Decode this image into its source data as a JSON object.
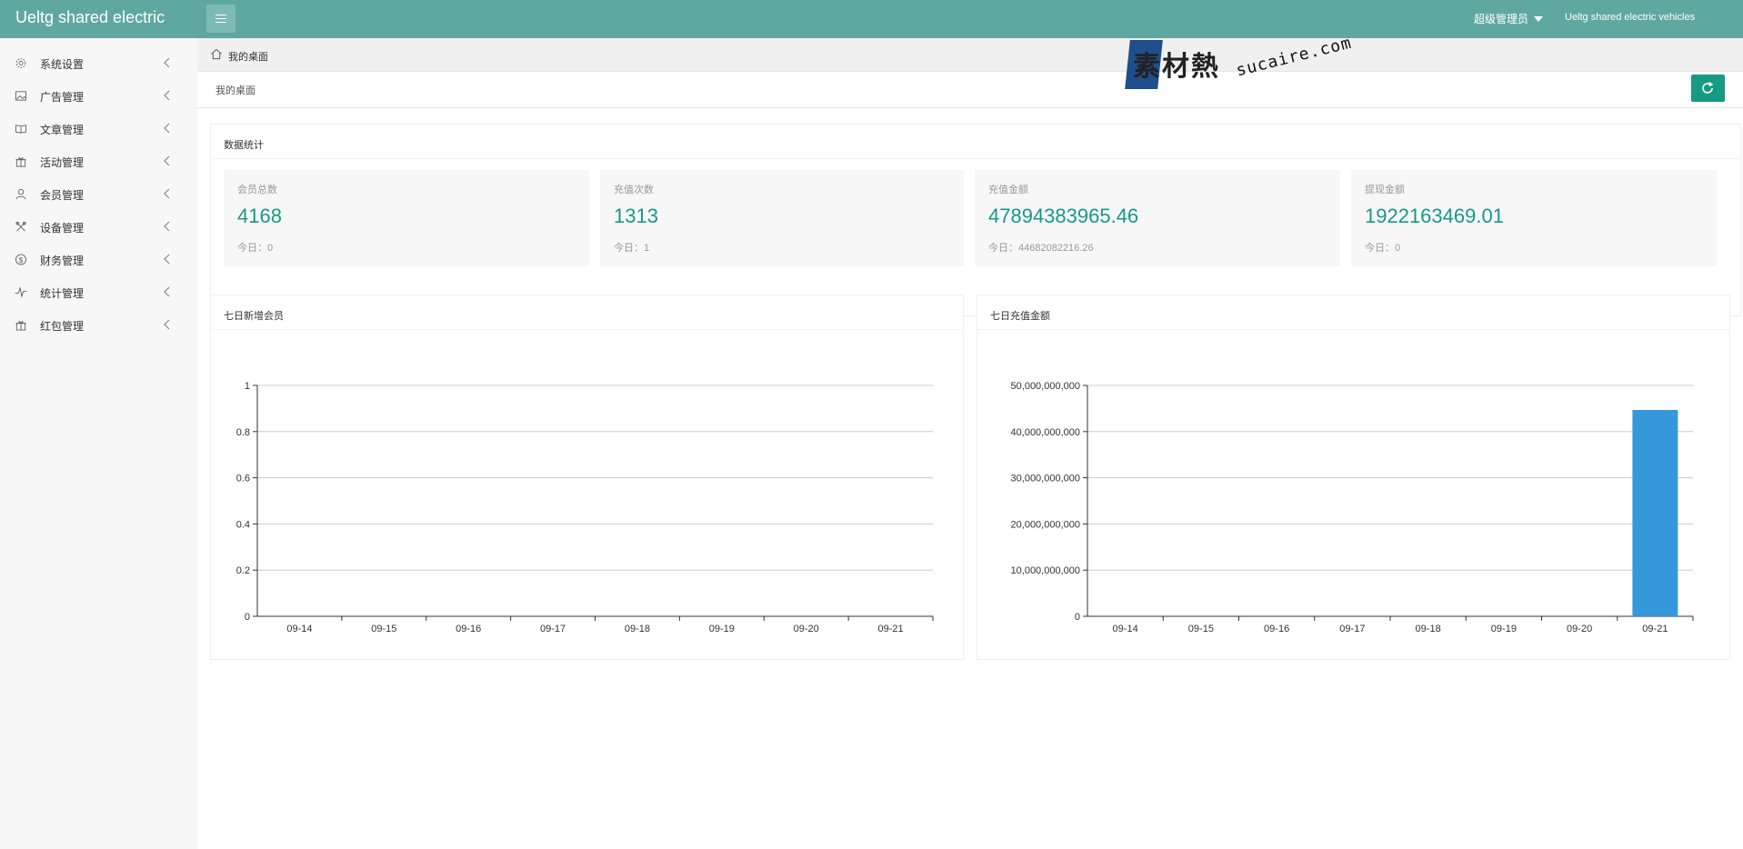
{
  "app": {
    "brand": "Ueltg shared electric",
    "user": "超级管理员",
    "site_link": "Ueltg shared electric vehicles"
  },
  "sidebar": {
    "items": [
      {
        "label": "系统设置",
        "icon": "gear-icon"
      },
      {
        "label": "广告管理",
        "icon": "image-icon"
      },
      {
        "label": "文章管理",
        "icon": "book-icon"
      },
      {
        "label": "活动管理",
        "icon": "gift-icon"
      },
      {
        "label": "会员管理",
        "icon": "user-icon"
      },
      {
        "label": "设备管理",
        "icon": "tools-icon"
      },
      {
        "label": "财务管理",
        "icon": "dollar-icon"
      },
      {
        "label": "统计管理",
        "icon": "pulse-icon"
      },
      {
        "label": "红包管理",
        "icon": "redpacket-icon"
      }
    ]
  },
  "breadcrumb": {
    "home": "我的桌面"
  },
  "page": {
    "title": "我的桌面"
  },
  "watermark": {
    "cn": "素材熱",
    "en": "sucaire.com"
  },
  "stats": {
    "title": "数据统计",
    "today_label": "今日：",
    "cards": [
      {
        "label": "会员总数",
        "value": "4168",
        "today": "0"
      },
      {
        "label": "充值次数",
        "value": "1313",
        "today": "1"
      },
      {
        "label": "充值金额",
        "value": "47894383965.46",
        "today": "44682082216.26"
      },
      {
        "label": "提现金额",
        "value": "1922163469.01",
        "today": "0"
      }
    ]
  },
  "colors": {
    "topbar": "#5fa8a0",
    "accent": "#169a83",
    "bar": "#3498db"
  },
  "chart_data": [
    {
      "type": "line",
      "title": "七日新增会员",
      "categories": [
        "09-14",
        "09-15",
        "09-16",
        "09-17",
        "09-18",
        "09-19",
        "09-20",
        "09-21"
      ],
      "values": [
        0,
        0,
        0,
        0,
        0,
        0,
        0,
        0
      ],
      "yticks": [
        "0",
        "0.2",
        "0.4",
        "0.6",
        "0.8",
        "1"
      ],
      "ylim": [
        0,
        1
      ],
      "grid": true
    },
    {
      "type": "bar",
      "title": "七日充值金额",
      "categories": [
        "09-14",
        "09-15",
        "09-16",
        "09-17",
        "09-18",
        "09-19",
        "09-20",
        "09-21"
      ],
      "values": [
        0,
        0,
        0,
        0,
        0,
        0,
        0,
        44682082216.26
      ],
      "yticks": [
        "0",
        "10,000,000,000",
        "20,000,000,000",
        "30,000,000,000",
        "40,000,000,000",
        "50,000,000,000"
      ],
      "ylim": [
        0,
        50000000000
      ],
      "grid": true
    }
  ]
}
